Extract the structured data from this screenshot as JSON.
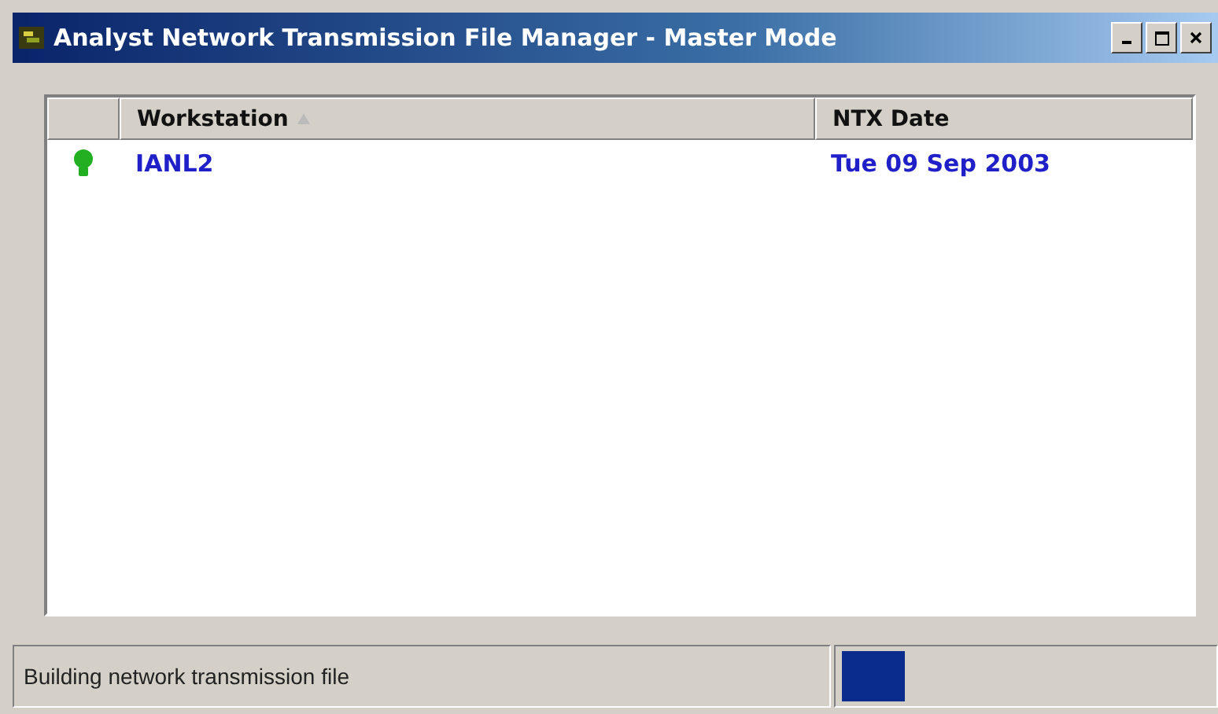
{
  "window": {
    "title": "Analyst Network Transmission File Manager - Master Mode"
  },
  "table": {
    "columns": [
      {
        "label": "Workstation",
        "sorted": true
      },
      {
        "label": "NTX Date",
        "sorted": false
      }
    ],
    "rows": [
      {
        "color": "#22b022",
        "workstation": "IANL2",
        "ntx_date": "Tue 09 Sep 2003"
      }
    ]
  },
  "status_bar": {
    "text": "Building network transmission file",
    "progress": {
      "level": 0.17
    }
  }
}
